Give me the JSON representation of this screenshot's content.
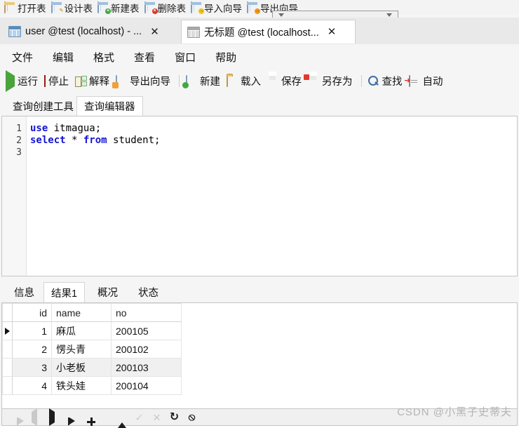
{
  "top_toolbar": {
    "items": [
      {
        "label": "打开表",
        "icon": "open-table-icon",
        "badge": ""
      },
      {
        "label": "设计表",
        "icon": "design-table-icon",
        "badge": "pencil"
      },
      {
        "label": "新建表",
        "icon": "new-table-icon",
        "badge": "green"
      },
      {
        "label": "删除表",
        "icon": "delete-table-icon",
        "badge": "red"
      },
      {
        "label": "导入向导",
        "icon": "import-wizard-icon",
        "badge": "yellow"
      },
      {
        "label": "导出向导",
        "icon": "export-wizard-icon",
        "badge": "orange"
      }
    ]
  },
  "window_tabs": [
    {
      "label": "user @test (localhost) - ...",
      "icon": "table-window-icon",
      "active": false,
      "close": "✕"
    },
    {
      "label": "无标题 @test (localhost...",
      "icon": "query-window-icon",
      "active": true,
      "close": "✕"
    }
  ],
  "menubar": {
    "items": [
      "文件",
      "编辑",
      "格式",
      "查看",
      "窗口",
      "帮助"
    ]
  },
  "main_toolbar": {
    "items": [
      {
        "label": "运行",
        "icon": "run-icon"
      },
      {
        "label": "停止",
        "icon": "stop-icon"
      },
      {
        "label": "解释",
        "icon": "explain-icon"
      },
      {
        "label": "导出向导",
        "icon": "export-wizard-icon"
      },
      {
        "label": "新建",
        "icon": "new-query-icon"
      },
      {
        "label": "载入",
        "icon": "load-icon"
      },
      {
        "label": "保存",
        "icon": "save-icon"
      },
      {
        "label": "另存为",
        "icon": "save-as-icon"
      },
      {
        "label": "查找",
        "icon": "find-icon"
      },
      {
        "label": "自动",
        "icon": "autocomplete-icon"
      }
    ]
  },
  "sub_tabs": [
    {
      "label": "查询创建工具",
      "active": false
    },
    {
      "label": "查询编辑器",
      "active": true
    }
  ],
  "editor": {
    "line_numbers": [
      "1",
      "2",
      "3"
    ],
    "lines": [
      [
        {
          "t": "use",
          "c": "kw"
        },
        {
          "t": " itmagua;",
          "c": "pl"
        }
      ],
      [
        {
          "t": "select",
          "c": "kw"
        },
        {
          "t": " * ",
          "c": "pl"
        },
        {
          "t": "from",
          "c": "kw"
        },
        {
          "t": " student;",
          "c": "pl"
        }
      ],
      []
    ]
  },
  "result_tabs": [
    {
      "label": "信息",
      "active": false
    },
    {
      "label": "结果1",
      "active": true
    },
    {
      "label": "概况",
      "active": false
    },
    {
      "label": "状态",
      "active": false
    }
  ],
  "grid": {
    "columns": [
      "id",
      "name",
      "no"
    ],
    "rows": [
      {
        "marker": true,
        "highlight": false,
        "cells": [
          "1",
          "麻瓜",
          "200105"
        ]
      },
      {
        "marker": false,
        "highlight": false,
        "cells": [
          "2",
          "愣头青",
          "200102"
        ]
      },
      {
        "marker": false,
        "highlight": true,
        "cells": [
          "3",
          "小老板",
          "200103"
        ]
      },
      {
        "marker": false,
        "highlight": false,
        "cells": [
          "4",
          "铁头娃",
          "200104"
        ]
      }
    ]
  },
  "nav_bar": {
    "buttons": [
      {
        "name": "first-record-button",
        "icon": "first-icon",
        "disabled": true
      },
      {
        "name": "prev-record-button",
        "icon": "prev-icon",
        "disabled": true
      },
      {
        "name": "next-record-button",
        "icon": "next-icon",
        "disabled": false
      },
      {
        "name": "last-record-button",
        "icon": "last-icon",
        "disabled": false
      },
      {
        "name": "add-record-button",
        "icon": "plus-icon",
        "disabled": false
      },
      {
        "name": "delete-record-button",
        "icon": "minus-icon",
        "disabled": false
      },
      {
        "name": "edit-record-button",
        "icon": "up-arrow-icon",
        "disabled": false
      },
      {
        "name": "confirm-button",
        "icon": "check-icon",
        "disabled": true,
        "glyph": "✓"
      },
      {
        "name": "cancel-edit-button",
        "icon": "cross-icon",
        "disabled": true,
        "glyph": "✕"
      },
      {
        "name": "refresh-button",
        "icon": "refresh-icon",
        "disabled": false,
        "glyph": "↻"
      },
      {
        "name": "stop-loading-button",
        "icon": "stop-circle-icon",
        "disabled": false,
        "glyph": "⦸"
      }
    ]
  },
  "watermark": {
    "text": "CSDN @小黑子史蒂夫"
  },
  "colors": {
    "keyword": "#1414d2",
    "accent_green": "#4aa33c",
    "accent_red": "#d42d23",
    "window_bg": "#f5f5f5"
  }
}
